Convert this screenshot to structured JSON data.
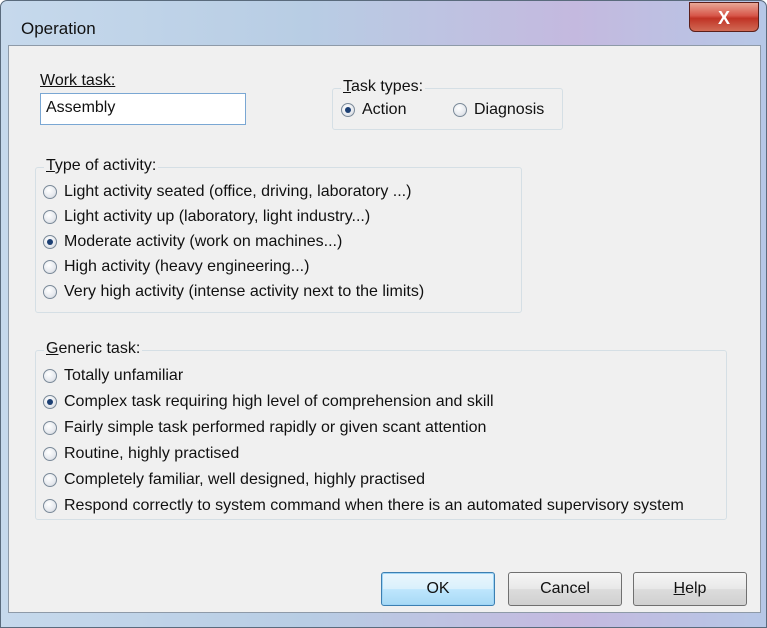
{
  "window": {
    "title": "Operation",
    "close_glyph": "X"
  },
  "work_task": {
    "label": "Work task:",
    "value": "Assembly"
  },
  "task_types": {
    "label_underlined": "T",
    "label_rest": "ask types:",
    "options": [
      {
        "label": "Action",
        "checked": true
      },
      {
        "label": "Diagnosis",
        "checked": false
      }
    ]
  },
  "type_of_activity": {
    "label_underlined": "T",
    "label_rest": "ype of activity:",
    "options": [
      {
        "label": "Light activity seated (office, driving, laboratory ...)",
        "checked": false
      },
      {
        "label": "Light activity up (laboratory, light industry...)",
        "checked": false
      },
      {
        "label": "Moderate activity (work on machines...)",
        "checked": true
      },
      {
        "label": "High activity (heavy engineering...)",
        "checked": false
      },
      {
        "label": "Very high activity (intense activity next to the limits)",
        "checked": false
      }
    ]
  },
  "generic_task": {
    "label_underlined": "G",
    "label_rest": "eneric task:",
    "options": [
      {
        "label": "Totally unfamiliar",
        "checked": false
      },
      {
        "label": "Complex task requiring high level of comprehension and skill",
        "checked": true
      },
      {
        "label": "Fairly simple task performed rapidly or given scant attention",
        "checked": false
      },
      {
        "label": "Routine, highly practised",
        "checked": false
      },
      {
        "label": "Completely familiar, well designed, highly practised",
        "checked": false
      },
      {
        "label": "Respond correctly to system command when there is an automated supervisory system",
        "checked": false
      }
    ]
  },
  "buttons": {
    "ok": "OK",
    "cancel": "Cancel",
    "help_underlined": "H",
    "help_rest": "elp"
  }
}
